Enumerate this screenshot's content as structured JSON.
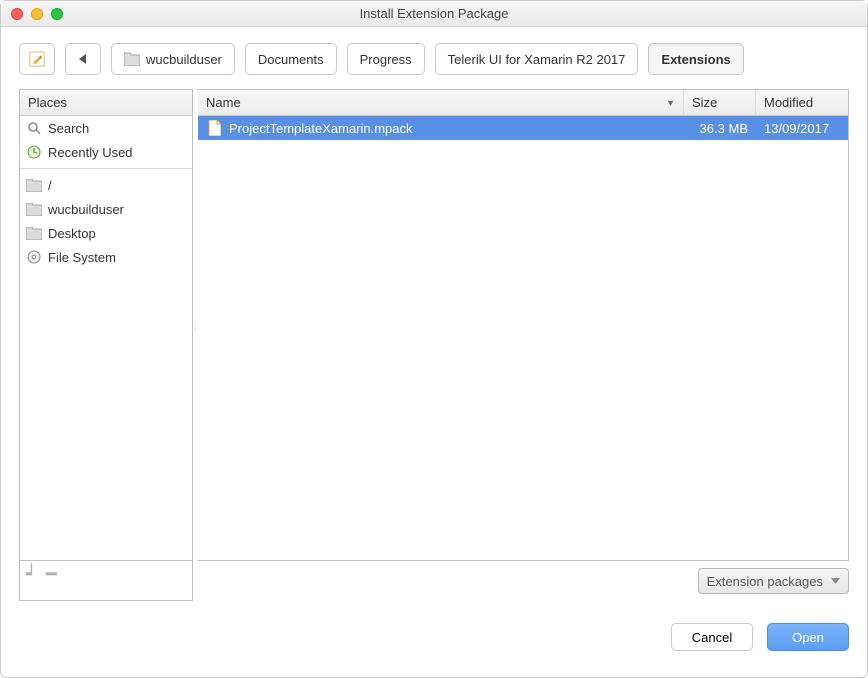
{
  "window": {
    "title": "Install Extension Package"
  },
  "breadcrumb": {
    "items": [
      {
        "label": "wucbuilduser",
        "icon": true
      },
      {
        "label": "Documents"
      },
      {
        "label": "Progress"
      },
      {
        "label": "Telerik UI for Xamarin R2 2017"
      },
      {
        "label": "Extensions",
        "active": true
      }
    ]
  },
  "sidebar": {
    "header": "Places",
    "groups": [
      [
        {
          "icon": "search-icon",
          "label": "Search"
        },
        {
          "icon": "recent-icon",
          "label": "Recently Used"
        }
      ],
      [
        {
          "icon": "folder-icon",
          "label": "/"
        },
        {
          "icon": "folder-icon",
          "label": "wucbuilduser"
        },
        {
          "icon": "folder-icon",
          "label": "Desktop"
        },
        {
          "icon": "disk-icon",
          "label": "File System"
        }
      ]
    ]
  },
  "filelist": {
    "columns": {
      "name": "Name",
      "size": "Size",
      "modified": "Modified"
    },
    "rows": [
      {
        "name": "ProjectTemplateXamarin.mpack",
        "size": "36.3 MB",
        "modified": "13/09/2017",
        "selected": true
      }
    ]
  },
  "footer": {
    "filter": "Extension packages",
    "cancel": "Cancel",
    "open": "Open"
  }
}
